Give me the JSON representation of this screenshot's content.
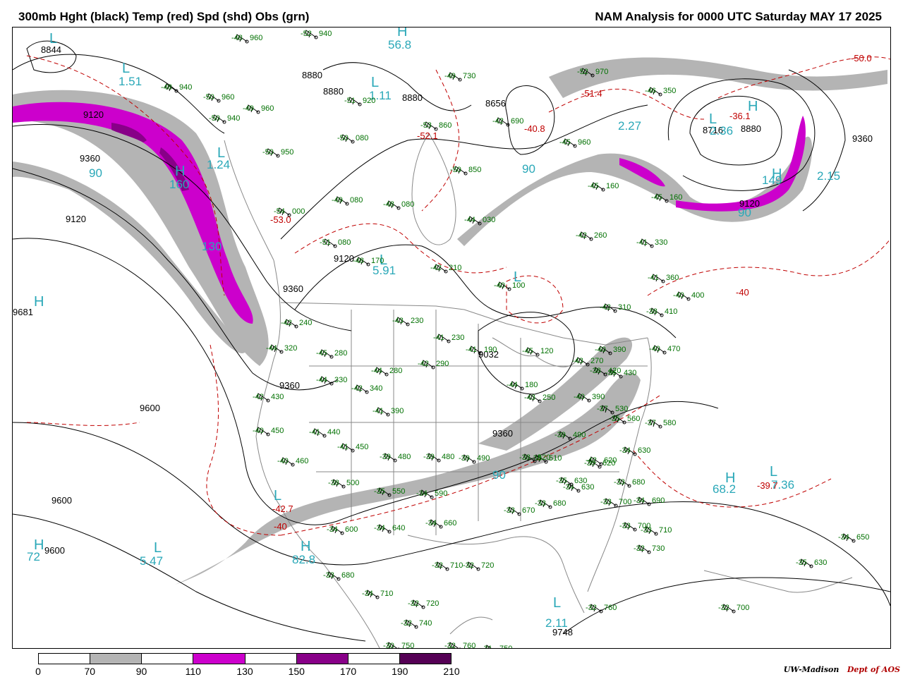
{
  "header": {
    "title_left": "300mb Hght (black) Temp (red) Spd (shd) Obs (grn)",
    "title_right": "NAM Analysis for 0000 UTC Saturday  MAY 17 2025"
  },
  "colors": {
    "height_contour": "#000000",
    "temp_contour": "#c00000",
    "speed_label": "#2aa8b8",
    "obs": "#007000",
    "map_lines": "#888888"
  },
  "speed_scale": {
    "ticks": [
      "0",
      "70",
      "90",
      "110",
      "130",
      "150",
      "170",
      "190",
      "210"
    ],
    "fill_colors": [
      "#ffffff",
      "#b4b4b4",
      "#ffffff",
      "#cc00cc",
      "#ffffff",
      "#880088",
      "#ffffff",
      "#550055"
    ]
  },
  "height_labels": [
    "8844",
    "9120",
    "9360",
    "8880",
    "8880",
    "8880",
    "8656",
    "8716",
    "8880",
    "9120",
    "9360",
    "9120",
    "9120",
    "9360",
    "9600",
    "9681",
    "9032",
    "9360",
    "9360",
    "9600",
    "9600",
    "9748"
  ],
  "temp_labels": [
    "-50.0",
    "-51.4",
    "-36.1",
    "-52.1",
    "-40.8",
    "-53.0",
    "-42.7",
    "-40",
    "-40",
    "-39.7"
  ],
  "speed_labels": [
    "56.8",
    "1.51",
    "1.11",
    "2.27",
    "2.36",
    "1.24",
    "160",
    "130",
    "5.91",
    "2.15",
    "68.2",
    "7.36",
    "72",
    "5.47",
    "82.8",
    "2.11",
    "149",
    "90",
    "90",
    "90",
    "90"
  ],
  "highs_lows": {
    "high": "H",
    "low": "L"
  },
  "obs": [
    {
      "t": "-48",
      "v": "960"
    },
    {
      "t": "-52",
      "v": "940"
    },
    {
      "t": "-48",
      "v": "940"
    },
    {
      "t": "-50",
      "v": "960"
    },
    {
      "t": "-49",
      "v": "960"
    },
    {
      "t": "-50",
      "v": "940"
    },
    {
      "t": "-50",
      "v": "950"
    },
    {
      "t": "-51",
      "v": "920"
    },
    {
      "t": "-53",
      "v": "860"
    },
    {
      "t": "-49",
      "v": "730"
    },
    {
      "t": "-42",
      "v": "690"
    },
    {
      "t": "-50",
      "v": "080"
    },
    {
      "t": "-50",
      "v": "850"
    },
    {
      "t": "-49",
      "v": "080"
    },
    {
      "t": "-48",
      "v": "080"
    },
    {
      "t": "-54",
      "v": "000"
    },
    {
      "t": "-51",
      "v": "080"
    },
    {
      "t": "-44",
      "v": "030"
    },
    {
      "t": "-42",
      "v": "260"
    },
    {
      "t": "-41",
      "v": "330"
    },
    {
      "t": "-48",
      "v": "170"
    },
    {
      "t": "-42",
      "v": "210"
    },
    {
      "t": "-40",
      "v": "100"
    },
    {
      "t": "-41",
      "v": "360"
    },
    {
      "t": "-40",
      "v": "400"
    },
    {
      "t": "-42",
      "v": "310"
    },
    {
      "t": "-38",
      "v": "410"
    },
    {
      "t": "-42",
      "v": "240"
    },
    {
      "t": "-43",
      "v": "230"
    },
    {
      "t": "-41",
      "v": "230"
    },
    {
      "t": "-41",
      "v": "190"
    },
    {
      "t": "-45",
      "v": "120"
    },
    {
      "t": "-44",
      "v": "320"
    },
    {
      "t": "-45",
      "v": "280"
    },
    {
      "t": "-42",
      "v": "290"
    },
    {
      "t": "-44",
      "v": "280"
    },
    {
      "t": "-44",
      "v": "330"
    },
    {
      "t": "-42",
      "v": "340"
    },
    {
      "t": "-44",
      "v": "180"
    },
    {
      "t": "-42",
      "v": "430"
    },
    {
      "t": "-41",
      "v": "390"
    },
    {
      "t": "-40",
      "v": "450"
    },
    {
      "t": "-41",
      "v": "440"
    },
    {
      "t": "-41",
      "v": "450"
    },
    {
      "t": "-40",
      "v": "460"
    },
    {
      "t": "-39",
      "v": "480"
    },
    {
      "t": "-39",
      "v": "480"
    },
    {
      "t": "-39",
      "v": "490"
    },
    {
      "t": "-38",
      "v": "500"
    },
    {
      "t": "-35",
      "v": "550"
    },
    {
      "t": "-34",
      "v": "590"
    },
    {
      "t": "-37",
      "v": "530"
    },
    {
      "t": "-35",
      "v": "560"
    },
    {
      "t": "-37",
      "v": "580"
    },
    {
      "t": "-34",
      "v": "630"
    },
    {
      "t": "-33",
      "v": "680"
    },
    {
      "t": "-34",
      "v": "600"
    },
    {
      "t": "-34",
      "v": "640"
    },
    {
      "t": "-34",
      "v": "660"
    },
    {
      "t": "-33",
      "v": "670"
    },
    {
      "t": "-33",
      "v": "680"
    },
    {
      "t": "-33",
      "v": "700"
    },
    {
      "t": "-32",
      "v": "710"
    },
    {
      "t": "-32",
      "v": "720"
    },
    {
      "t": "-33",
      "v": "680"
    },
    {
      "t": "-34",
      "v": "710"
    },
    {
      "t": "-32",
      "v": "720"
    },
    {
      "t": "-32",
      "v": "740"
    },
    {
      "t": "-30",
      "v": "750"
    },
    {
      "t": "-32",
      "v": "760"
    },
    {
      "t": "-31",
      "v": "750"
    },
    {
      "t": "-32",
      "v": "760"
    },
    {
      "t": "-33",
      "v": "700"
    },
    {
      "t": "-33",
      "v": "710"
    },
    {
      "t": "-32",
      "v": "730"
    },
    {
      "t": "-34",
      "v": "690"
    },
    {
      "t": "-34",
      "v": "650"
    },
    {
      "t": "-35",
      "v": "630"
    },
    {
      "t": "-32",
      "v": "700"
    },
    {
      "t": "-46",
      "v": "350"
    },
    {
      "t": "-52",
      "v": "970"
    },
    {
      "t": "-45",
      "v": "960"
    },
    {
      "t": "-45",
      "v": "160"
    },
    {
      "t": "-45",
      "v": "160"
    },
    {
      "t": "-40",
      "v": "390"
    },
    {
      "t": "-38",
      "v": "420"
    },
    {
      "t": "-40",
      "v": "390"
    },
    {
      "t": "-39",
      "v": "490"
    },
    {
      "t": "-38",
      "v": "510"
    },
    {
      "t": "-38",
      "v": "520"
    },
    {
      "t": "-34",
      "v": "630"
    },
    {
      "t": "-43",
      "v": "270"
    },
    {
      "t": "-43",
      "v": "250"
    },
    {
      "t": "-40",
      "v": "470"
    },
    {
      "t": "-42",
      "v": "620"
    },
    {
      "t": "-36",
      "v": "620"
    },
    {
      "t": "-35",
      "v": "630"
    },
    {
      "t": "-36",
      "v": "430"
    }
  ],
  "credit": {
    "institution": "UW-Madison",
    "department": "Dept of AOS"
  }
}
